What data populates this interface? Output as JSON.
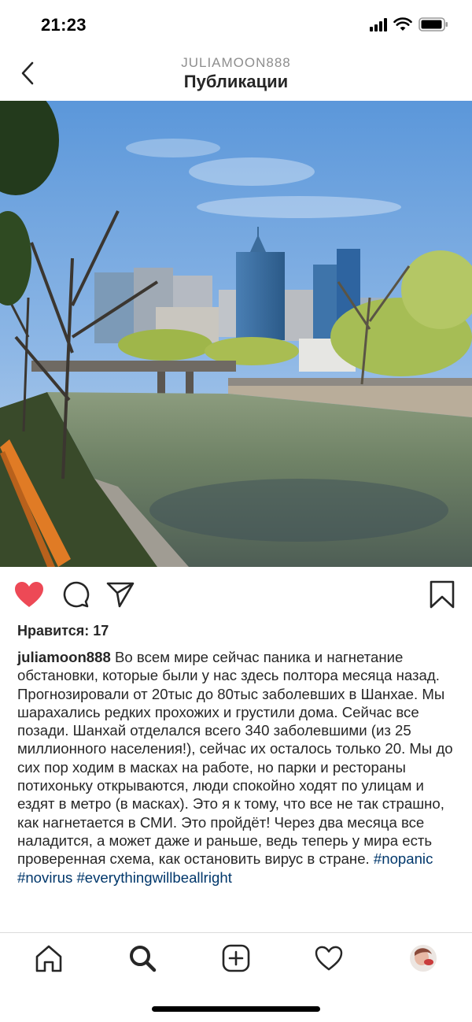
{
  "status_bar": {
    "time": "21:23"
  },
  "header": {
    "username": "JULIAMOON888",
    "title": "Публикации"
  },
  "post": {
    "likes_label": "Нравится: 17",
    "author": "juliamoon888",
    "caption_text": "Во всем мире сейчас паника и нагнетание обстановки, которые были у нас здесь полтора месяца назад. Прогнозировали от 20тыс до 80тыс заболевших в Шанхае. Мы шарахались редких прохожих и грустили дома. Сейчас все позади. Шанхай отделался всего 340 заболевшими (из 25 миллионного населения!), сейчас их осталось только 20. Мы до сих пор ходим в масках на работе, но парки и рестораны потихоньку открываются, люди спокойно ходят по улицам и ездят в метро (в масках). Это я к тому, что все не так страшно, как нагнетается в СМИ. Это пройдёт! Через два месяца все наладится, а может даже и раньше, ведь теперь у мира есть проверенная схема, как остановить вирус в стране.",
    "hashtags": [
      "#nopanic",
      "#novirus",
      "#everythingwillbeallright"
    ],
    "liked": true
  },
  "colors": {
    "like_red": "#ed4956",
    "hashtag_blue": "#00376b",
    "text": "#262626",
    "muted": "#8e8e8e"
  },
  "icons": {
    "header": [
      "chevron-left-icon"
    ],
    "actions": [
      "heart-filled-icon",
      "comment-icon",
      "share-icon",
      "bookmark-icon"
    ],
    "nav": [
      "home-icon",
      "search-icon",
      "add-post-icon",
      "activity-heart-icon",
      "profile-avatar"
    ]
  }
}
